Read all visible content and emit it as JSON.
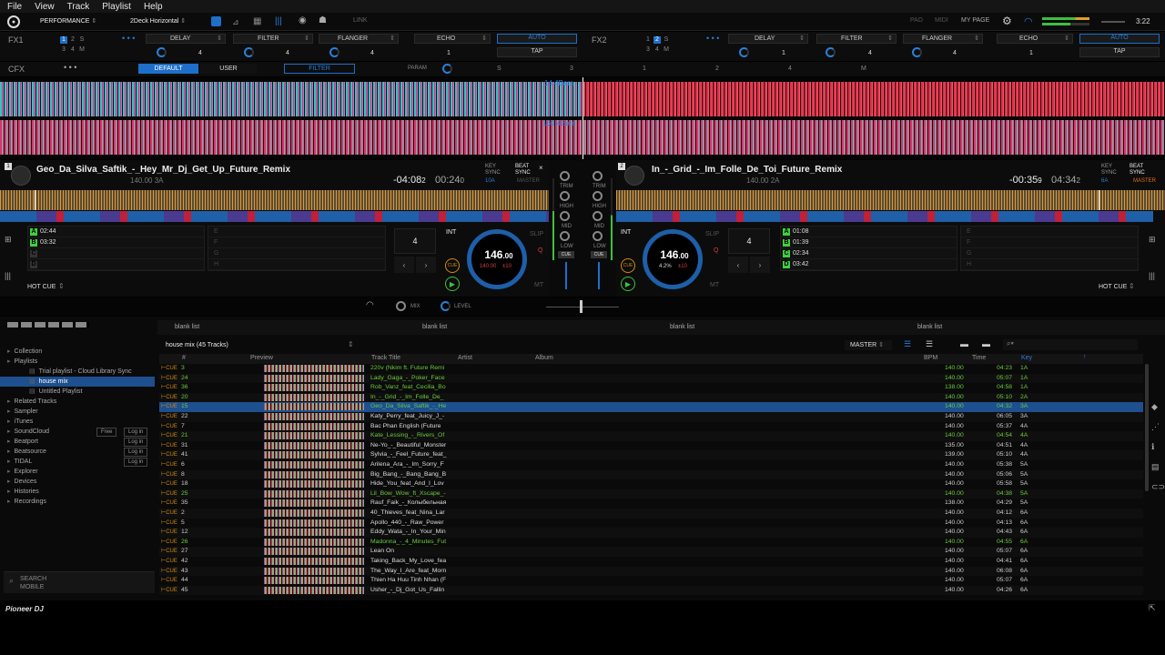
{
  "menu": [
    "File",
    "View",
    "Track",
    "Playlist",
    "Help"
  ],
  "topbar": {
    "mode": "PERFORMANCE",
    "layout": "2Deck Horizontal",
    "link": "LINK",
    "pad": "PAD",
    "midi": "MIDI",
    "mypage": "MY PAGE",
    "time": "3:22"
  },
  "fx1": {
    "label": "FX1",
    "nums": [
      "1",
      "2",
      "S",
      "3",
      "4",
      "M"
    ],
    "slots": [
      "DELAY",
      "FILTER",
      "FLANGER",
      "ECHO"
    ],
    "vals": [
      "4",
      "4",
      "4",
      "1"
    ],
    "auto": "AUTO",
    "tap": "TAP"
  },
  "fx2": {
    "label": "FX2",
    "nums": [
      "1",
      "2",
      "S",
      "3",
      "4",
      "M"
    ],
    "slots": [
      "DELAY",
      "FILTER",
      "FLANGER",
      "ECHO"
    ],
    "vals": [
      "1",
      "4",
      "4",
      "1"
    ],
    "auto": "AUTO",
    "tap": "TAP"
  },
  "cfx": {
    "label": "CFX",
    "default": "DEFAULT",
    "user": "USER",
    "filter": "FILTER",
    "param": "PARAM",
    "s": "S",
    "n3": "3",
    "n1": "1",
    "n2": "2",
    "n4": "4",
    "m": "M"
  },
  "overview": {
    "bars1": "14.4Bars",
    "bars2": "160.4Bars"
  },
  "deck1": {
    "num": "1",
    "title": "Geo_Da_Silva_Saftik_-_Hey_Mr_Dj_Get_Up_Future_Remix",
    "sub": "140.00 3A",
    "remain": "-04:08",
    "remain_dec": "2",
    "elapsed": "00:24",
    "elapsed_dec": "0",
    "key_sync": "KEY SYNC",
    "key_val": "10A",
    "beat_sync": "BEAT SYNC",
    "master": "MASTER",
    "cues": [
      {
        "l": "A",
        "t": "02:44",
        "c": "#40d040"
      },
      {
        "l": "B",
        "t": "03:32",
        "c": "#40d040"
      },
      {
        "l": "C",
        "t": "",
        "c": "#333"
      },
      {
        "l": "D",
        "t": "",
        "c": "#333"
      }
    ],
    "cues2": [
      "E",
      "F",
      "G",
      "H"
    ],
    "loop": "4",
    "int": "INT",
    "bpm": "146",
    "bpm_dec": ".00",
    "bpm2": "140.00",
    "range": "±10",
    "slip": "SLIP",
    "q": "Q",
    "cue": "CUE",
    "mt": "MT",
    "hotcue": "HOT CUE"
  },
  "deck2": {
    "num": "2",
    "title": "In_-_Grid_-_Im_Folle_De_Toi_Future_Remix",
    "sub": "140.00 2A",
    "remain": "-00:35",
    "remain_dec": "9",
    "elapsed": "04:34",
    "elapsed_dec": "2",
    "key_sync": "KEY SYNC",
    "key_val": "6A",
    "beat_sync": "BEAT SYNC",
    "master": "MASTER",
    "cues": [
      {
        "l": "A",
        "t": "01:08",
        "c": "#40d040"
      },
      {
        "l": "B",
        "t": "01:39",
        "c": "#40d040"
      },
      {
        "l": "C",
        "t": "02:34",
        "c": "#40d040"
      },
      {
        "l": "D",
        "t": "03:42",
        "c": "#40d040"
      }
    ],
    "cues2": [
      "E",
      "F",
      "G",
      "H"
    ],
    "loop": "4",
    "int": "INT",
    "bpm": "146",
    "bpm_dec": ".00",
    "bpm2": "4.2%",
    "range": "±10",
    "slip": "SLIP",
    "q": "Q",
    "cue": "CUE",
    "mt": "MT",
    "hotcue": "HOT CUE"
  },
  "mixer": {
    "trim": "TRIM",
    "high": "HIGH",
    "mid": "MID",
    "low": "LOW",
    "cue": "CUE",
    "mix": "MIX",
    "level": "LEVEL"
  },
  "browser": {
    "panes": [
      "blank list",
      "blank list",
      "blank list",
      "blank list"
    ],
    "playlist": "house mix (45 Tracks)",
    "master": "MASTER",
    "cols": [
      "#",
      "Preview",
      "Track Title",
      "Artist",
      "Album",
      "BPM",
      "Time",
      "Key"
    ],
    "tree": [
      {
        "l": "Collection",
        "d": 0
      },
      {
        "l": "Playlists",
        "d": 0
      },
      {
        "l": "Trial playlist - Cloud Library Sync",
        "d": 2
      },
      {
        "l": "house mix",
        "d": 2,
        "sel": true
      },
      {
        "l": "Untitled Playlist",
        "d": 2
      },
      {
        "l": "Related Tracks",
        "d": 0
      },
      {
        "l": "Sampler",
        "d": 0
      },
      {
        "l": "iTunes",
        "d": 0
      },
      {
        "l": "SoundCloud",
        "d": 0,
        "b": "Free",
        "b2": "Log in"
      },
      {
        "l": "Beatport",
        "d": 0,
        "b2": "Log in"
      },
      {
        "l": "Beatsource",
        "d": 0,
        "b2": "Log in"
      },
      {
        "l": "TIDAL",
        "d": 0,
        "b2": "Log in"
      },
      {
        "l": "Explorer",
        "d": 0
      },
      {
        "l": "Devices",
        "d": 0
      },
      {
        "l": "Histories",
        "d": 0
      },
      {
        "l": "Recordings",
        "d": 0
      }
    ],
    "search": "SEARCH",
    "mobile": "MOBILE",
    "rows": [
      {
        "n": "3",
        "t": "220v (Nkim ft. Future Remi",
        "bpm": "140.00",
        "time": "04:23",
        "key": "1A",
        "g": 1
      },
      {
        "n": "24",
        "t": "Lady_Gaga_-_Poker_Face",
        "bpm": "140.00",
        "time": "05:07",
        "key": "1A",
        "g": 1
      },
      {
        "n": "36",
        "t": "Rob_Vanz_feat_Cecilia_Bo",
        "bpm": "138.00",
        "time": "04:58",
        "key": "1A",
        "g": 1
      },
      {
        "n": "20",
        "t": "In_-_Grid_-_Im_Folle_De_",
        "bpm": "140.00",
        "time": "05:10",
        "key": "2A",
        "g": 1
      },
      {
        "n": "15",
        "t": "Geo_Da_Silva_Saftik_-_He",
        "bpm": "140.00",
        "time": "04:32",
        "key": "3A",
        "g": 1,
        "sel": true
      },
      {
        "n": "22",
        "t": "Katy_Perry_feat_Juicy_J_-",
        "bpm": "140.00",
        "time": "06:05",
        "key": "3A"
      },
      {
        "n": "7",
        "t": "Bac Phan English (Future",
        "bpm": "140.00",
        "time": "05:37",
        "key": "4A"
      },
      {
        "n": "21",
        "t": "Kate_Lessing_-_Rivers_Of",
        "bpm": "140.00",
        "time": "04:54",
        "key": "4A",
        "g": 1
      },
      {
        "n": "31",
        "t": "Ne-Yo_-_Beautiful_Monster",
        "bpm": "135.00",
        "time": "04:51",
        "key": "4A"
      },
      {
        "n": "41",
        "t": "Sylvia_-_Feel_Future_feat_",
        "bpm": "139.00",
        "time": "05:10",
        "key": "4A"
      },
      {
        "n": "6",
        "t": "Arilena_Ara_-_Im_Sorry_F",
        "bpm": "140.00",
        "time": "05:38",
        "key": "5A"
      },
      {
        "n": "8",
        "t": "Big_Bang_-_Bang_Bang_B",
        "bpm": "140.00",
        "time": "05:06",
        "key": "5A"
      },
      {
        "n": "18",
        "t": "Hide_You_feat_And_I_Lov",
        "bpm": "140.00",
        "time": "05:58",
        "key": "5A"
      },
      {
        "n": "25",
        "t": "Lil_Bow_Wow_ft_Xscape_-",
        "bpm": "140.00",
        "time": "04:38",
        "key": "5A",
        "g": 1
      },
      {
        "n": "35",
        "t": "Rauf_Faik_-_Колыбельная",
        "bpm": "138.00",
        "time": "04:29",
        "key": "5A"
      },
      {
        "n": "2",
        "t": "40_Thieves_feat_Nina_Lar",
        "bpm": "140.00",
        "time": "04:12",
        "key": "6A"
      },
      {
        "n": "5",
        "t": "Apollo_440_-_Raw_Power",
        "bpm": "140.00",
        "time": "04:13",
        "key": "6A"
      },
      {
        "n": "12",
        "t": "Eddy_Wata_-_In_Your_Min",
        "bpm": "140.00",
        "time": "04:43",
        "key": "6A"
      },
      {
        "n": "26",
        "t": "Madonna_-_4_Minutes_Fut",
        "bpm": "140.00",
        "time": "04:55",
        "key": "6A",
        "g": 1
      },
      {
        "n": "27",
        "t": "Lean On",
        "bpm": "140.00",
        "time": "05:07",
        "key": "6A"
      },
      {
        "n": "42",
        "t": "Taking_Back_My_Love_fea",
        "bpm": "140.00",
        "time": "04:41",
        "key": "6A"
      },
      {
        "n": "43",
        "t": "The_Way_I_Are_feat_Morn",
        "bpm": "140.00",
        "time": "06:08",
        "key": "6A"
      },
      {
        "n": "44",
        "t": "Thien Ha Huu Tinh Nhan (F",
        "bpm": "140.00",
        "time": "05:07",
        "key": "6A"
      },
      {
        "n": "45",
        "t": "Usher_-_Dj_Got_Us_Fallin",
        "bpm": "140.00",
        "time": "04:26",
        "key": "6A"
      }
    ]
  },
  "footer": {
    "brand": "Pioneer DJ"
  },
  "colors": {
    "accent": "#1e6fc9",
    "green": "#40d040",
    "waveRed": "#e0306e",
    "waveCyan": "#33d1c6"
  }
}
